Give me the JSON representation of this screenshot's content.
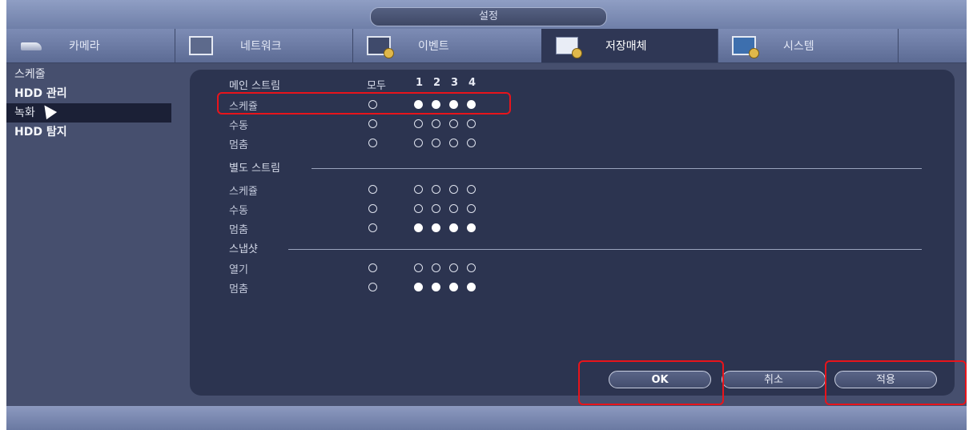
{
  "window": {
    "title": "설정"
  },
  "tabs": [
    {
      "label": "카메라",
      "icon": "camera-icon"
    },
    {
      "label": "네트워크",
      "icon": "network-icon"
    },
    {
      "label": "이벤트",
      "icon": "event-icon"
    },
    {
      "label": "저장매체",
      "icon": "storage-icon",
      "active": true
    },
    {
      "label": "시스템",
      "icon": "system-icon"
    }
  ],
  "sidebar": {
    "items": [
      {
        "label": "스케줄"
      },
      {
        "label": "HDD 관리"
      },
      {
        "label": "녹화",
        "active": true
      },
      {
        "label": "HDD 탐지"
      }
    ]
  },
  "record": {
    "main_stream": {
      "title": "메인 스트림",
      "all_label": "모두",
      "channels": [
        "1",
        "2",
        "3",
        "4"
      ],
      "rows": [
        {
          "label": "스케쥴",
          "all": false,
          "channels": [
            true,
            true,
            true,
            true
          ]
        },
        {
          "label": "수동",
          "all": false,
          "channels": [
            false,
            false,
            false,
            false
          ]
        },
        {
          "label": "멈춤",
          "all": false,
          "channels": [
            false,
            false,
            false,
            false
          ]
        }
      ]
    },
    "sub_stream": {
      "title": "별도 스트림",
      "rows": [
        {
          "label": "스케쥴",
          "all": false,
          "channels": [
            false,
            false,
            false,
            false
          ]
        },
        {
          "label": "수동",
          "all": false,
          "channels": [
            false,
            false,
            false,
            false
          ]
        },
        {
          "label": "멈춤",
          "all": false,
          "channels": [
            true,
            true,
            true,
            true
          ]
        }
      ]
    },
    "snapshot": {
      "title": "스냅샷",
      "rows": [
        {
          "label": "열기",
          "all": false,
          "channels": [
            false,
            false,
            false,
            false
          ]
        },
        {
          "label": "멈춤",
          "all": false,
          "channels": [
            true,
            true,
            true,
            true
          ]
        }
      ]
    }
  },
  "buttons": {
    "ok": "OK",
    "cancel": "취소",
    "apply": "적용"
  },
  "colors": {
    "highlight": "#e8141b",
    "panel": "#2c3450",
    "background": "#464f6e"
  }
}
